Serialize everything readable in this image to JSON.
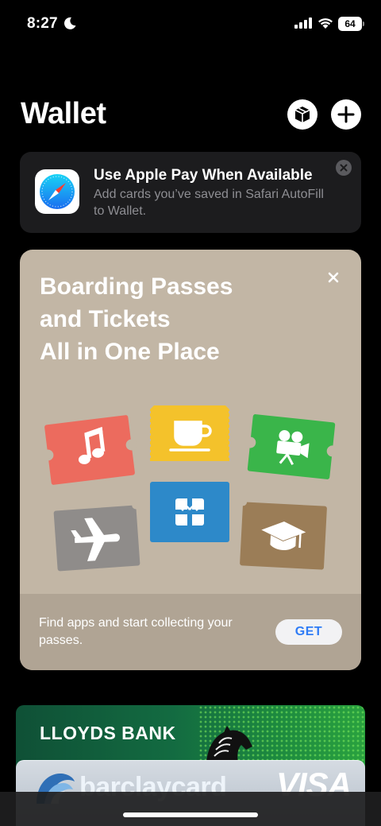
{
  "status_bar": {
    "time": "8:27",
    "battery": "64",
    "icons": [
      "moon-icon",
      "cellular-signal-icon",
      "wifi-icon",
      "battery-icon"
    ]
  },
  "header": {
    "title": "Wallet",
    "buttons": [
      {
        "name": "orders-box-button",
        "icon": "box-icon"
      },
      {
        "name": "add-card-button",
        "icon": "plus-icon"
      }
    ]
  },
  "suggestion": {
    "title": "Use Apple Pay When Available",
    "body": "Add cards you’ve saved in Safari AutoFill to Wallet.",
    "icon": "safari-icon"
  },
  "promo": {
    "headline_lines": [
      "Boarding Passes",
      "and Tickets",
      "All in One Place"
    ],
    "message": "Find apps and start collecting your passes.",
    "get_label": "GET",
    "ticket_icons": [
      "music-note-icon",
      "coffee-cup-icon",
      "movie-camera-icon",
      "airplane-icon",
      "gift-icon",
      "graduation-cap-icon"
    ],
    "colors": {
      "background": "#c2b6a5",
      "footer": "#b0a494",
      "get_text": "#2f7cf6"
    }
  },
  "cards": {
    "lloyds": {
      "name": "LLOYDS BANK"
    },
    "barclaycard": {
      "name": "barclaycard",
      "network": "VISA"
    }
  }
}
